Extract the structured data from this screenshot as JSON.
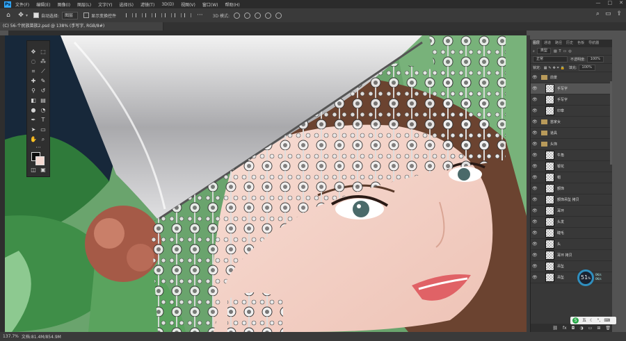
{
  "menu": {
    "logo": "Ps",
    "items": [
      "文件(F)",
      "编辑(E)",
      "图像(I)",
      "图层(L)",
      "文字(Y)",
      "选择(S)",
      "滤镜(T)",
      "3D(D)",
      "视图(V)",
      "窗口(W)",
      "帮助(H)"
    ],
    "minimize": "—",
    "maximize": "□",
    "close": "✕"
  },
  "options": {
    "home_icon": "home-icon",
    "move_icon": "move-icon",
    "auto_select_label": "自动选择:",
    "auto_select_value": "图层",
    "show_transform_label": "显示变换控件",
    "mode_label": "3D 模式:",
    "more": "···"
  },
  "document": {
    "tab_title": "(C) 56-个民族苗族2.psd @ 138% (手写字, RGB/8#)",
    "zoom": "137.7%",
    "doc_info": "文档:81.4M/854.9M"
  },
  "panel": {
    "tabs": [
      "图层",
      "通道",
      "路径",
      "历史",
      "色板",
      "导航器"
    ],
    "filter_label": "类型",
    "blend_mode": "正常",
    "opacity_label": "不透明度:",
    "opacity_value": "100%",
    "lock_label": "锁定:",
    "fill_label": "填充:",
    "fill_value": "100%",
    "layers": [
      {
        "name": "前景",
        "group": true
      },
      {
        "name": "手写字",
        "group": false,
        "selected": true
      },
      {
        "name": "手写字",
        "group": false
      },
      {
        "name": "印章",
        "group": false
      },
      {
        "name": "苗家女",
        "group": true
      },
      {
        "name": "道具",
        "group": true
      },
      {
        "name": "头饰",
        "group": true
      },
      {
        "name": "牛角",
        "group": false
      },
      {
        "name": "银花",
        "group": false
      },
      {
        "name": "帽",
        "group": false
      },
      {
        "name": "额饰",
        "group": false
      },
      {
        "name": "额饰吊坠 拷贝",
        "group": false
      },
      {
        "name": "耳环",
        "group": false
      },
      {
        "name": "头发",
        "group": false
      },
      {
        "name": "睫毛",
        "group": false
      },
      {
        "name": "头",
        "group": false
      },
      {
        "name": "耳环 拷贝",
        "group": false
      },
      {
        "name": "吊坠",
        "group": false
      },
      {
        "name": "吊坠",
        "group": false
      }
    ]
  },
  "widget": {
    "percent": "51",
    "unit": "%",
    "up": "0K/s",
    "down": "0K/s",
    "brand": "五"
  },
  "colors": {
    "foreground": "#0d0d0d",
    "background": "#f3d9d2",
    "accent": "#31a8ff"
  }
}
